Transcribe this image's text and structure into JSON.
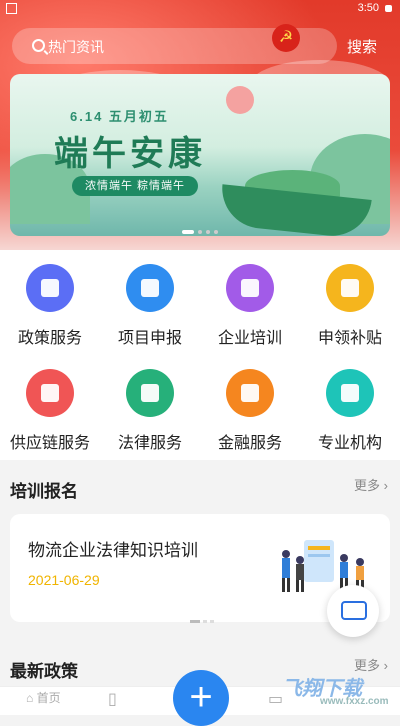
{
  "status": {
    "left": "▣",
    "time": "3:50"
  },
  "search": {
    "placeholder": "热门资讯",
    "button": "搜索"
  },
  "banner": {
    "date": "6.14 五月初五",
    "title": "端午安康",
    "tagline": "浓情端午 粽情端午"
  },
  "menu": [
    {
      "label": "政策服务",
      "color": "#5b6ef5"
    },
    {
      "label": "项目申报",
      "color": "#2f8df0"
    },
    {
      "label": "企业培训",
      "color": "#a25be8"
    },
    {
      "label": "申领补贴",
      "color": "#f5b51d"
    },
    {
      "label": "供应链服务",
      "color": "#f05555"
    },
    {
      "label": "法律服务",
      "color": "#26b07a"
    },
    {
      "label": "金融服务",
      "color": "#f5861f"
    },
    {
      "label": "专业机构",
      "color": "#1ec4b8"
    }
  ],
  "training": {
    "title": "培训报名",
    "more": "更多",
    "card_title": "物流企业法律知识培训",
    "card_date": "2021-06-29"
  },
  "policy": {
    "title": "最新政策",
    "more": "更多"
  },
  "bottom": {
    "home": "首页",
    "watermark": "飞翔下载",
    "watermark_sub": "www.fxxz.com"
  },
  "colors": {
    "brand_red": "#e23a2a",
    "accent_blue": "#2a86f0",
    "date_yellow": "#f0b400"
  }
}
